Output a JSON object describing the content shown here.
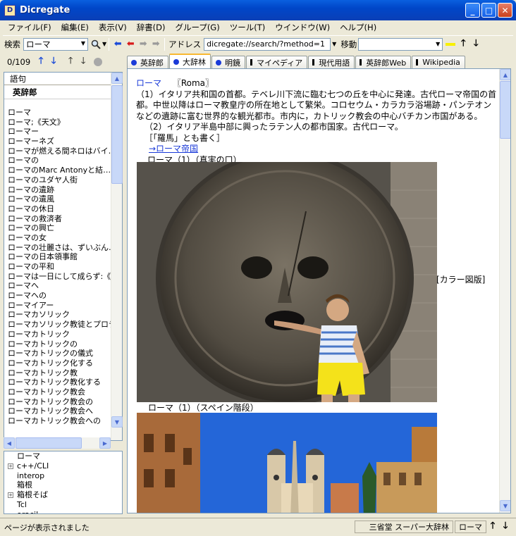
{
  "window": {
    "title": "Dicregate"
  },
  "menu": [
    "ファイル(F)",
    "編集(E)",
    "表示(V)",
    "辞書(D)",
    "グループ(G)",
    "ツール(T)",
    "ウインドウ(W)",
    "ヘルプ(H)"
  ],
  "toolbar": {
    "search_label": "検索",
    "search_value": "ローマ",
    "address_label": "アドレス",
    "address_value": "dicregate://search/?method=1",
    "move_label": "移動"
  },
  "left": {
    "counter": "0/109",
    "header": "語句",
    "dictionary": "英辞郎",
    "words": [
      "ローマ",
      "ローマ;《天文》",
      "ローマー",
      "ローマーネズ",
      "ローマが燃える間ネロはバイ…",
      "ローマの",
      "ローマのMarc Antonyと結…",
      "ローマのユダヤ人街",
      "ローマの遺跡",
      "ローマの遺風",
      "ローマの休日",
      "ローマの救済者",
      "ローマの興亡",
      "ローマの女",
      "ローマの壮麗さは、ずいぶん…",
      "ローマの日本領事館",
      "ローマの平和",
      "ローマは一日にして成らず:《…",
      "ローマへ",
      "ローマへの",
      "ローマイアー",
      "ローマカソリック",
      "ローマカソリック教徒とプロテ…",
      "ローマカトリック",
      "ローマカトリックの",
      "ローマカトリックの儀式",
      "ローマカトリック化する",
      "ローマカトリック教",
      "ローマカトリック教化する",
      "ローマカトリック教会",
      "ローマカトリック教会の",
      "ローマカトリック教会へ",
      "ローマカトリック教会への"
    ],
    "tree": [
      {
        "label": "ローマ",
        "expandable": false
      },
      {
        "label": "c++/CLI",
        "expandable": true
      },
      {
        "label": "interop",
        "expandable": false
      },
      {
        "label": "箱根",
        "expandable": false
      },
      {
        "label": "箱根そば",
        "expandable": true
      },
      {
        "label": "Tcl",
        "expandable": false
      },
      {
        "label": "oracil",
        "expandable": false
      }
    ]
  },
  "tabs": [
    {
      "label": "英辞郎",
      "marker": "dot",
      "active": false
    },
    {
      "label": "大辞林",
      "marker": "dot",
      "active": true
    },
    {
      "label": "明鏡",
      "marker": "dot",
      "active": false
    },
    {
      "label": "マイペディア",
      "marker": "bar",
      "active": false
    },
    {
      "label": "現代用語",
      "marker": "bar",
      "active": false
    },
    {
      "label": "英辞郎Web",
      "marker": "bar",
      "active": false
    },
    {
      "label": "Wikipedia",
      "marker": "bar",
      "active": false
    }
  ],
  "entry": {
    "headword": "ローマ",
    "origin": "〖Roma〗",
    "def1": "（1）イタリア共和国の首都。テベレ川下流に臨む七つの丘を中心に発達。古代ローマ帝国の首都。中世以降はローマ教皇庁の所在地として繁栄。コロセウム・カラカラ浴場跡・パンテオンなどの遺跡に富む世界的な観光都市。市内に，カトリック教会の中心バチカン市国がある。",
    "def2": "（2）イタリア半島中部に興ったラテン人の都市国家。古代ローマ。",
    "note": "［「羅馬」とも書く］",
    "link": "→ローマ帝国",
    "caption1": "ローマ（1）（真実の口）",
    "color_plate": "[カラー図版]",
    "caption2": "ローマ（1）（スペイン階段）"
  },
  "status": {
    "message": "ページが表示されました",
    "publisher": "三省堂  スーパー大辞林",
    "word": "ローマ"
  },
  "colors": {
    "title_bar": "#0a5fdf",
    "link": "#1a3ad8",
    "active_tab": "#f8b830"
  }
}
